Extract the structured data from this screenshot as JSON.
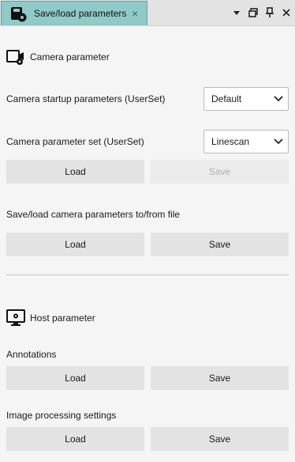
{
  "tab": {
    "title": "Save/load parameters",
    "close_glyph": "×",
    "icon": "camera-save-icon"
  },
  "toolbar": {
    "menu_icon": "dropdown-arrow-icon",
    "restore_icon": "restore-window-icon",
    "pin_icon": "pin-icon",
    "close_icon": "close-icon"
  },
  "camera_section": {
    "title": "Camera parameter",
    "icon": "camera-settings-icon",
    "startup_label": "Camera startup parameters (UserSet)",
    "startup_value": "Default",
    "set_label": "Camera parameter set (UserSet)",
    "set_value": "Linescan",
    "set_load": "Load",
    "set_save": "Save",
    "file_label": "Save/load camera parameters to/from file",
    "file_load": "Load",
    "file_save": "Save"
  },
  "host_section": {
    "title": "Host parameter",
    "icon": "monitor-settings-icon",
    "annotations_label": "Annotations",
    "annotations_load": "Load",
    "annotations_save": "Save",
    "processing_label": "Image processing settings",
    "processing_load": "Load",
    "processing_save": "Save"
  },
  "colors": {
    "tab_active": "#8fcac6",
    "button_bg": "#e3e3e3",
    "disabled_text": "#b0b0b0"
  }
}
